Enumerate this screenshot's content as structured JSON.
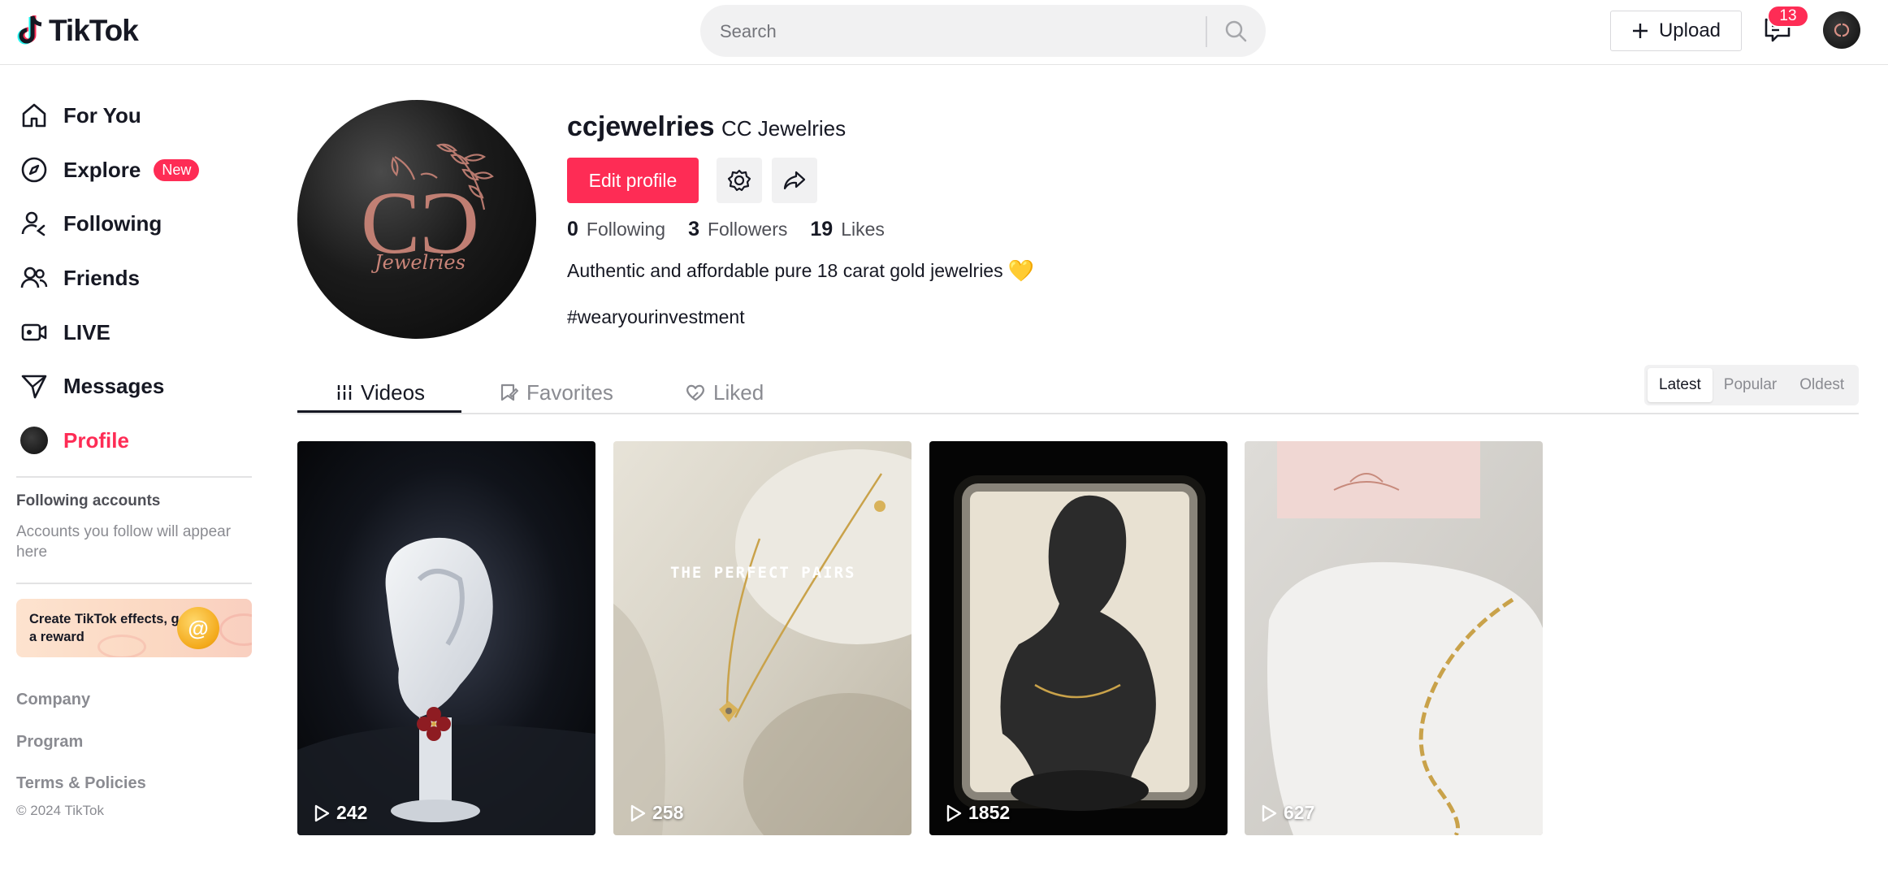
{
  "brand": {
    "name": "TikTok"
  },
  "search": {
    "placeholder": "Search"
  },
  "header": {
    "upload_label": "Upload",
    "inbox_count": "13"
  },
  "sidebar": {
    "items": [
      {
        "label": "For You",
        "icon": "home-icon"
      },
      {
        "label": "Explore",
        "icon": "compass-icon",
        "badge": "New"
      },
      {
        "label": "Following",
        "icon": "following-icon"
      },
      {
        "label": "Friends",
        "icon": "friends-icon"
      },
      {
        "label": "LIVE",
        "icon": "live-icon"
      },
      {
        "label": "Messages",
        "icon": "messages-icon"
      },
      {
        "label": "Profile",
        "icon": "profile-avatar",
        "active": true
      }
    ],
    "following_title": "Following accounts",
    "following_sub": "Accounts you follow will appear here",
    "effects_card": "Create TikTok effects, get a reward",
    "footer": [
      "Company",
      "Program",
      "Terms & Policies"
    ],
    "copyright": "© 2024 TikTok"
  },
  "profile": {
    "username": "ccjewelries",
    "display_name": "CC Jewelries",
    "edit_label": "Edit profile",
    "stats": [
      {
        "value": "0",
        "label": "Following"
      },
      {
        "value": "3",
        "label": "Followers"
      },
      {
        "value": "19",
        "label": "Likes"
      }
    ],
    "bio": "Authentic and affordable pure 18 carat gold jewelries",
    "bio_emoji": "💛",
    "hashtag": "#wearyourinvestment",
    "avatar_text": "Jewelries"
  },
  "tabs": [
    {
      "label": "Videos",
      "active": true
    },
    {
      "label": "Favorites"
    },
    {
      "label": "Liked"
    }
  ],
  "sort": [
    {
      "label": "Latest",
      "active": true
    },
    {
      "label": "Popular"
    },
    {
      "label": "Oldest"
    }
  ],
  "videos": [
    {
      "views": "242"
    },
    {
      "views": "258",
      "overlay": "THE PERFECT PAIRS"
    },
    {
      "views": "1852"
    },
    {
      "views": "627"
    }
  ],
  "colors": {
    "accent": "#fe2c55",
    "text": "#161823",
    "muted": "#8a8b91"
  }
}
